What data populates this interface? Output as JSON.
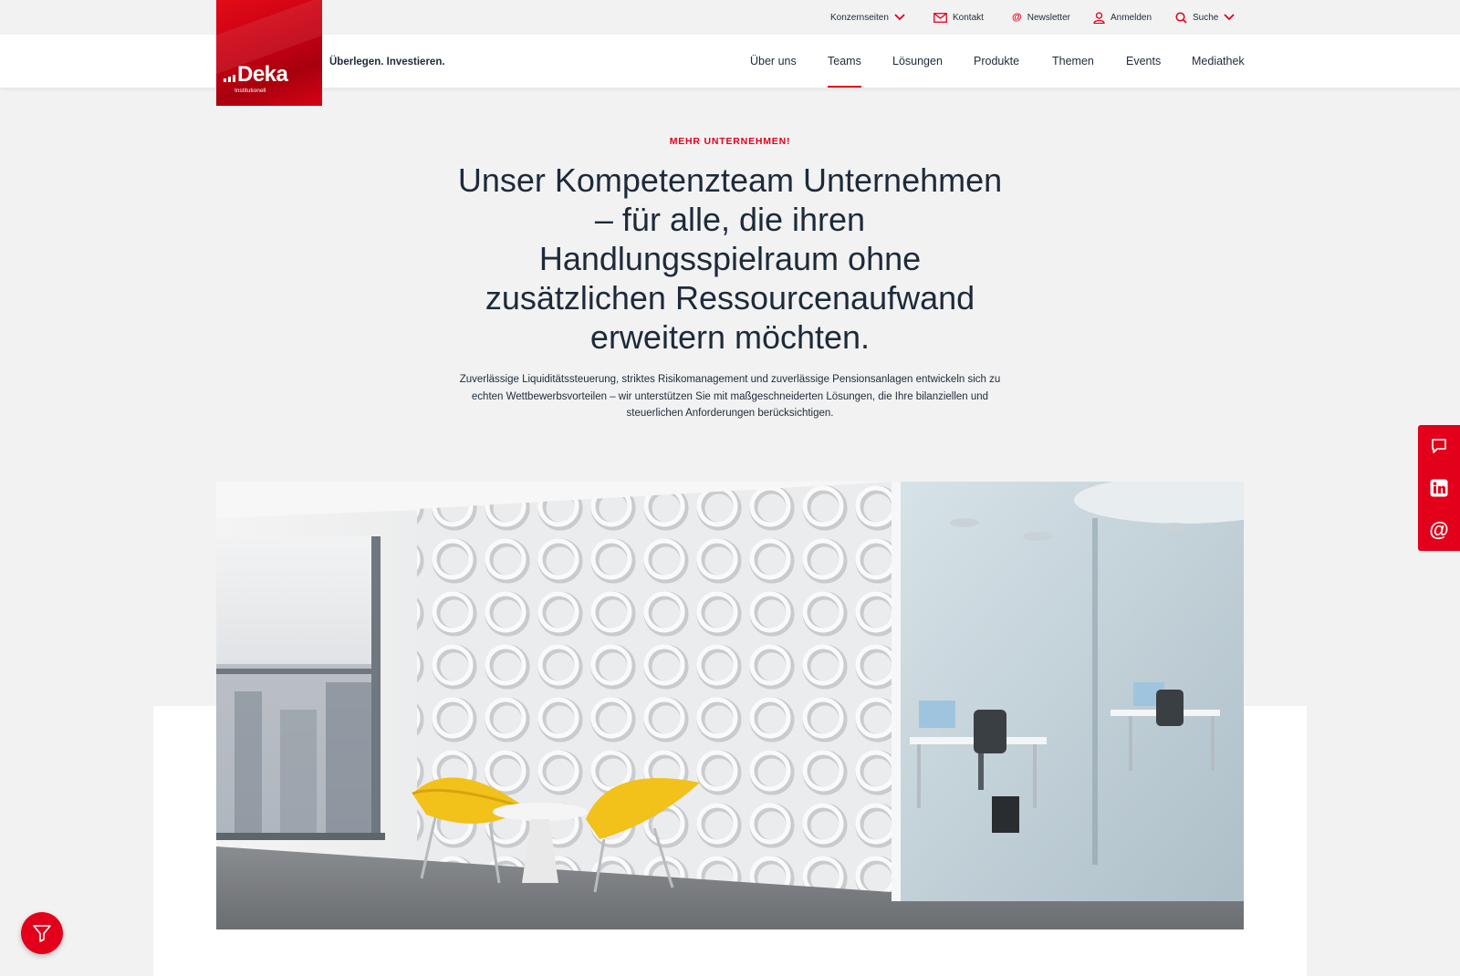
{
  "utility_bar": {
    "konzernseiten": "Konzernseiten",
    "kontakt": "Kontakt",
    "newsletter": "Newsletter",
    "anmelden": "Anmelden",
    "suche": "Suche"
  },
  "brand": {
    "name": "Deka",
    "sub": "Institutionell",
    "tagline": "Überlegen. Investieren."
  },
  "nav": {
    "items": [
      {
        "label": "Über uns"
      },
      {
        "label": "Teams"
      },
      {
        "label": "Lösungen"
      },
      {
        "label": "Produkte"
      },
      {
        "label": "Themen"
      },
      {
        "label": "Events"
      },
      {
        "label": "Mediathek"
      }
    ],
    "active": "Teams"
  },
  "hero": {
    "eyebrow": "MEHR UNTERNEHMEN!",
    "headline": "Unser Kompetenzteam Unternehmen – für alle, die ihren Handlungsspielraum ohne zusätzlichen Ressourcenaufwand erweitern möchten.",
    "intro": "Zuverlässige Liquiditätssteuerung, striktes Risikomanagement und zuverlässige Pensionsanlagen entwickeln sich zu echten Wettbewerbsvorteilen – wir unterstützen Sie mit maßgeschneiderten Lösungen, die Ihre bilanziellen und steuerlichen Anforderungen berücksichtigen."
  },
  "side_actions": {
    "icons": [
      "chat-icon",
      "linkedin-icon",
      "email-at-icon"
    ]
  },
  "filter_button": {
    "icon": "filter-icon"
  },
  "colors": {
    "accent": "#e2001a",
    "text": "#1d2a3a",
    "background": "#f2f2f2"
  }
}
